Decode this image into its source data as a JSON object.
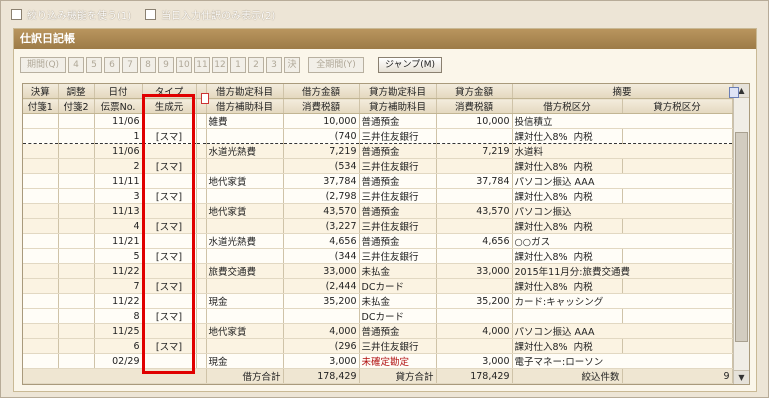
{
  "top_options": [
    {
      "label": "絞り込み機能を使う(1)"
    },
    {
      "label": "当日入力仕訳のみ表示(2)"
    }
  ],
  "panel": {
    "title": "仕訳日記帳"
  },
  "toolbar": {
    "period_label": "期間(Q)",
    "months": [
      "4",
      "5",
      "6",
      "7",
      "8",
      "9",
      "10",
      "11",
      "12",
      "1",
      "2",
      "3",
      "決"
    ],
    "all_period_label": "全期間(Y)",
    "jump_label": "ジャンプ(M)"
  },
  "headers": {
    "row1": [
      "決算",
      "調整",
      "日付",
      "タイプ",
      "",
      "借方勘定科目",
      "借方金額",
      "貸方勘定科目",
      "貸方金額",
      "摘要",
      ""
    ],
    "row2": [
      "付箋1",
      "付箋2",
      "伝票No.",
      "生成元",
      "",
      "借方補助科目",
      "消費税額",
      "貸方補助科目",
      "消費税額",
      "借方税区分",
      "貸方税区分"
    ]
  },
  "entries": [
    {
      "date": "11/06",
      "no": "1",
      "source": "[スマ]",
      "debit_acct": "雑費",
      "debit_sub": "",
      "debit_amt": "10,000",
      "debit_tax": "(740",
      "credit_acct": "普通預金",
      "credit_sub": "三井住友銀行",
      "credit_amt": "10,000",
      "credit_tax": "",
      "memo": "投信積立",
      "debit_taxcat": "課対仕入8%",
      "debit_taxtype": "内税",
      "credit_taxcat": ""
    },
    {
      "date": "11/06",
      "no": "2",
      "source": "[スマ]",
      "debit_acct": "水道光熱費",
      "debit_sub": "",
      "debit_amt": "7,219",
      "debit_tax": "(534",
      "credit_acct": "普通預金",
      "credit_sub": "三井住友銀行",
      "credit_amt": "7,219",
      "credit_tax": "",
      "memo": "水道料",
      "debit_taxcat": "課対仕入8%",
      "debit_taxtype": "内税",
      "credit_taxcat": ""
    },
    {
      "date": "11/11",
      "no": "3",
      "source": "[スマ]",
      "debit_acct": "地代家賃",
      "debit_sub": "",
      "debit_amt": "37,784",
      "debit_tax": "(2,798",
      "credit_acct": "普通預金",
      "credit_sub": "三井住友銀行",
      "credit_amt": "37,784",
      "credit_tax": "",
      "memo": "パソコン振込 AAA",
      "debit_taxcat": "課対仕入8%",
      "debit_taxtype": "内税",
      "credit_taxcat": ""
    },
    {
      "date": "11/13",
      "no": "4",
      "source": "[スマ]",
      "debit_acct": "地代家賃",
      "debit_sub": "",
      "debit_amt": "43,570",
      "debit_tax": "(3,227",
      "credit_acct": "普通預金",
      "credit_sub": "三井住友銀行",
      "credit_amt": "43,570",
      "credit_tax": "",
      "memo": "パソコン振込",
      "debit_taxcat": "課対仕入8%",
      "debit_taxtype": "内税",
      "credit_taxcat": ""
    },
    {
      "date": "11/21",
      "no": "5",
      "source": "[スマ]",
      "debit_acct": "水道光熱費",
      "debit_sub": "",
      "debit_amt": "4,656",
      "debit_tax": "(344",
      "credit_acct": "普通預金",
      "credit_sub": "三井住友銀行",
      "credit_amt": "4,656",
      "credit_tax": "",
      "memo": "○○ガス",
      "debit_taxcat": "課対仕入8%",
      "debit_taxtype": "内税",
      "credit_taxcat": ""
    },
    {
      "date": "11/22",
      "no": "7",
      "source": "[スマ]",
      "debit_acct": "旅費交通費",
      "debit_sub": "",
      "debit_amt": "33,000",
      "debit_tax": "(2,444",
      "credit_acct": "未払金",
      "credit_sub": "DCカード",
      "credit_amt": "33,000",
      "credit_tax": "",
      "memo": "2015年11月分:旅費交通費",
      "debit_taxcat": "課対仕入8%",
      "debit_taxtype": "内税",
      "credit_taxcat": ""
    },
    {
      "date": "11/22",
      "no": "8",
      "source": "[スマ]",
      "debit_acct": "現金",
      "debit_sub": "",
      "debit_amt": "35,200",
      "debit_tax": "",
      "credit_acct": "未払金",
      "credit_sub": "DCカード",
      "credit_amt": "35,200",
      "credit_tax": "",
      "memo": "カード:キャッシング",
      "debit_taxcat": "",
      "debit_taxtype": "",
      "credit_taxcat": ""
    },
    {
      "date": "11/25",
      "no": "6",
      "source": "[スマ]",
      "debit_acct": "地代家賃",
      "debit_sub": "",
      "debit_amt": "4,000",
      "debit_tax": "(296",
      "credit_acct": "普通預金",
      "credit_sub": "三井住友銀行",
      "credit_amt": "4,000",
      "credit_tax": "",
      "memo": "パソコン振込 AAA",
      "debit_taxcat": "課対仕入8%",
      "debit_taxtype": "内税",
      "credit_taxcat": ""
    },
    {
      "date": "02/29",
      "no": "",
      "source": "",
      "debit_acct": "現金",
      "debit_sub": "",
      "debit_amt": "3,000",
      "debit_tax": "",
      "credit_acct": "未確定勘定",
      "credit_sub": "",
      "credit_amt": "3,000",
      "credit_tax": "",
      "memo": "電子マネー:ローソン",
      "debit_taxcat": "",
      "debit_taxtype": "",
      "credit_taxcat": ""
    }
  ],
  "totals": {
    "debit_label": "借方合計",
    "debit_total": "178,429",
    "credit_label": "貸方合計",
    "credit_total": "178,429",
    "count_label": "絞込件数",
    "count": "9"
  },
  "colors": {
    "highlight": "#e00000",
    "title_bar": "#a88552",
    "unconfirmed": "#b01010"
  }
}
